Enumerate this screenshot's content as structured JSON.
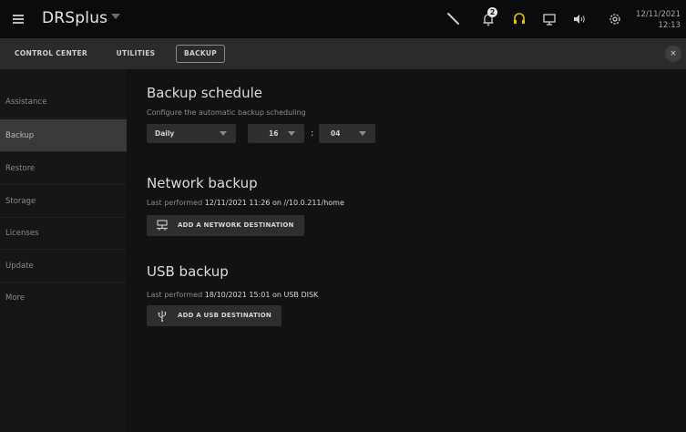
{
  "app": {
    "title": "DRSplus"
  },
  "topbar": {
    "notification_count": "2",
    "date": "12/11/2021",
    "time": "12:13",
    "icons": [
      "tool-icon",
      "bell-icon",
      "headset-icon",
      "monitor-icon",
      "speaker-icon",
      "gear-icon"
    ],
    "accent_color": "#e8c400"
  },
  "tabs": [
    {
      "label": "CONTROL CENTER"
    },
    {
      "label": "UTILITIES"
    },
    {
      "label": "BACKUP"
    }
  ],
  "close_label": "×",
  "sidebar": {
    "items": [
      {
        "label": "Assistance"
      },
      {
        "label": "Backup"
      },
      {
        "label": "Restore"
      },
      {
        "label": "Storage"
      },
      {
        "label": "Licenses"
      },
      {
        "label": "Update"
      },
      {
        "label": "More"
      }
    ]
  },
  "schedule": {
    "title": "Backup schedule",
    "description": "Configure the automatic backup scheduling",
    "frequency": "Daily",
    "hour": "16",
    "colon": ":",
    "minute": "04"
  },
  "network": {
    "title": "Network backup",
    "prefix": "Last performed",
    "when": "12/11/2021 11:26",
    "on": "on",
    "target": "//10.0.211/home",
    "button_label": "ADD A NETWORK DESTINATION"
  },
  "usb": {
    "title": "USB backup",
    "prefix": "Last performed",
    "when": "18/10/2021 15:01",
    "on": "on",
    "target": "USB DISK",
    "button_label": "ADD A USB DESTINATION"
  }
}
